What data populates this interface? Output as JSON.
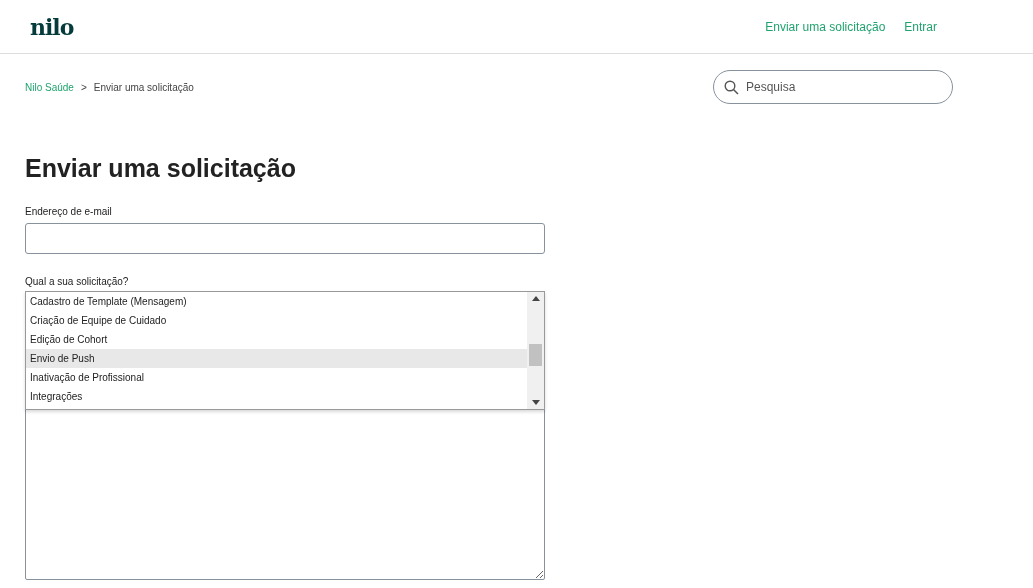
{
  "header": {
    "logo": "nilo",
    "nav": [
      "Enviar uma solicitação",
      "Entrar"
    ]
  },
  "breadcrumb": [
    "Nilo Saúde",
    "Enviar uma solicitação"
  ],
  "breadcrumb_separator": ">",
  "search": {
    "placeholder": "Pesquisa"
  },
  "title": "Enviar uma solicitação",
  "form": {
    "email_label": "Endereço de e-mail",
    "request_label": "Qual a sua solicitação?",
    "options": [
      {
        "label": "Cadastro de Template (Mensagem)",
        "selected": false
      },
      {
        "label": "Criação de Equipe de Cuidado",
        "selected": false
      },
      {
        "label": "Edição de Cohort",
        "selected": false
      },
      {
        "label": "Envio de Push",
        "selected": true
      },
      {
        "label": "Inativação de Profissional",
        "selected": false
      },
      {
        "label": "Integrações",
        "selected": false
      }
    ]
  }
}
